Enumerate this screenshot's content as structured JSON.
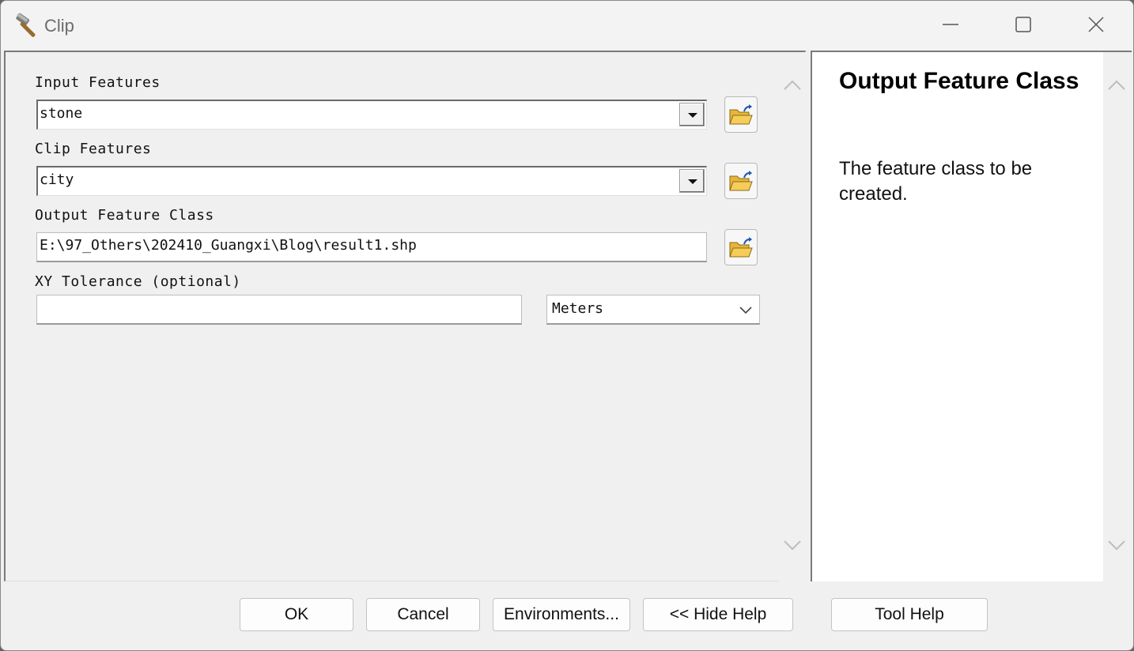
{
  "window": {
    "title": "Clip",
    "app_icon": "hammer-icon",
    "controls": [
      "minimize-icon",
      "maximize-icon",
      "close-icon"
    ]
  },
  "form": {
    "input_features": {
      "label": "Input Features",
      "value": "stone"
    },
    "clip_features": {
      "label": "Clip Features",
      "value": "city"
    },
    "output_feature_class": {
      "label": "Output Feature Class",
      "value": "E:\\97_Others\\202410_Guangxi\\Blog\\result1.shp"
    },
    "xy_tolerance": {
      "label": "XY Tolerance (optional)",
      "value": "",
      "units": "Meters"
    }
  },
  "help": {
    "title": "Output Feature Class",
    "text": "The feature class to be created."
  },
  "buttons": {
    "ok": "OK",
    "cancel": "Cancel",
    "environments": "Environments...",
    "hide_help": "<< Hide Help",
    "tool_help": "Tool Help"
  }
}
